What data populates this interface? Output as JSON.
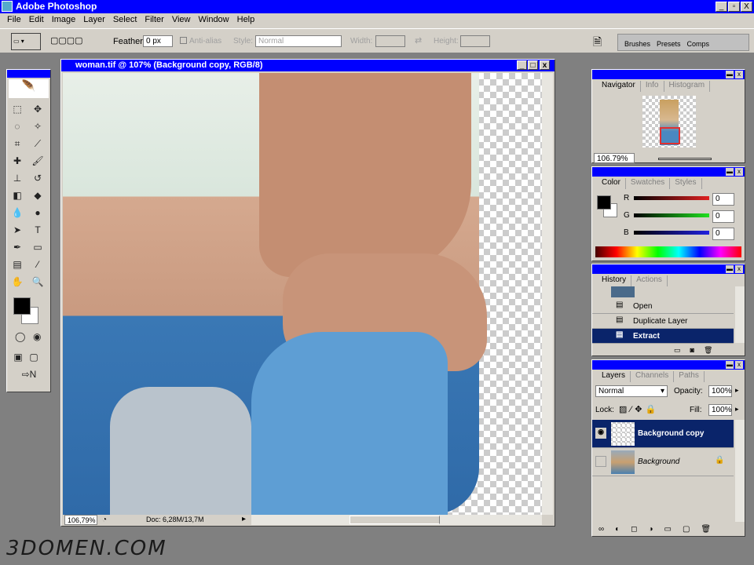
{
  "app": {
    "title": "Adobe Photoshop",
    "controls": [
      "_",
      "▫",
      "X"
    ]
  },
  "menu": [
    "File",
    "Edit",
    "Image",
    "Layer",
    "Select",
    "Filter",
    "View",
    "Window",
    "Help"
  ],
  "options": {
    "feather_label": "Feather:",
    "feather_value": "0 px",
    "antialias_label": "Anti-alias",
    "style_label": "Style:",
    "style_value": "Normal",
    "width_label": "Width:",
    "height_label": "Height:",
    "well_tabs": [
      "Brushes",
      "Presets",
      "Comps"
    ]
  },
  "document": {
    "title": "woman.tif @ 107% (Background copy, RGB/8)",
    "zoom": "106,79%",
    "doc_info": "Doc: 6,28M/13,7M"
  },
  "navigator": {
    "tabs": [
      "Navigator",
      "Info",
      "Histogram"
    ],
    "zoom": "106.79%"
  },
  "color": {
    "tabs": [
      "Color",
      "Swatches",
      "Styles"
    ],
    "r_label": "R",
    "g_label": "G",
    "b_label": "B",
    "r": "0",
    "g": "0",
    "b": "0",
    "foreground": "#000000",
    "background": "#ffffff"
  },
  "history": {
    "tabs": [
      "History",
      "Actions"
    ],
    "items": [
      "Open",
      "Duplicate Layer",
      "Extract"
    ],
    "selected": "Extract"
  },
  "layers": {
    "tabs": [
      "Layers",
      "Channels",
      "Paths"
    ],
    "blend": "Normal",
    "opacity_label": "Opacity:",
    "opacity": "100%",
    "lock_label": "Lock:",
    "fill_label": "Fill:",
    "fill": "100%",
    "items": [
      "Background copy",
      "Background"
    ]
  },
  "watermark": "3DOMEN.COM",
  "colors": {
    "title": "#0000ff",
    "chrome": "#d4d0c8",
    "selection": "#0a246a"
  }
}
